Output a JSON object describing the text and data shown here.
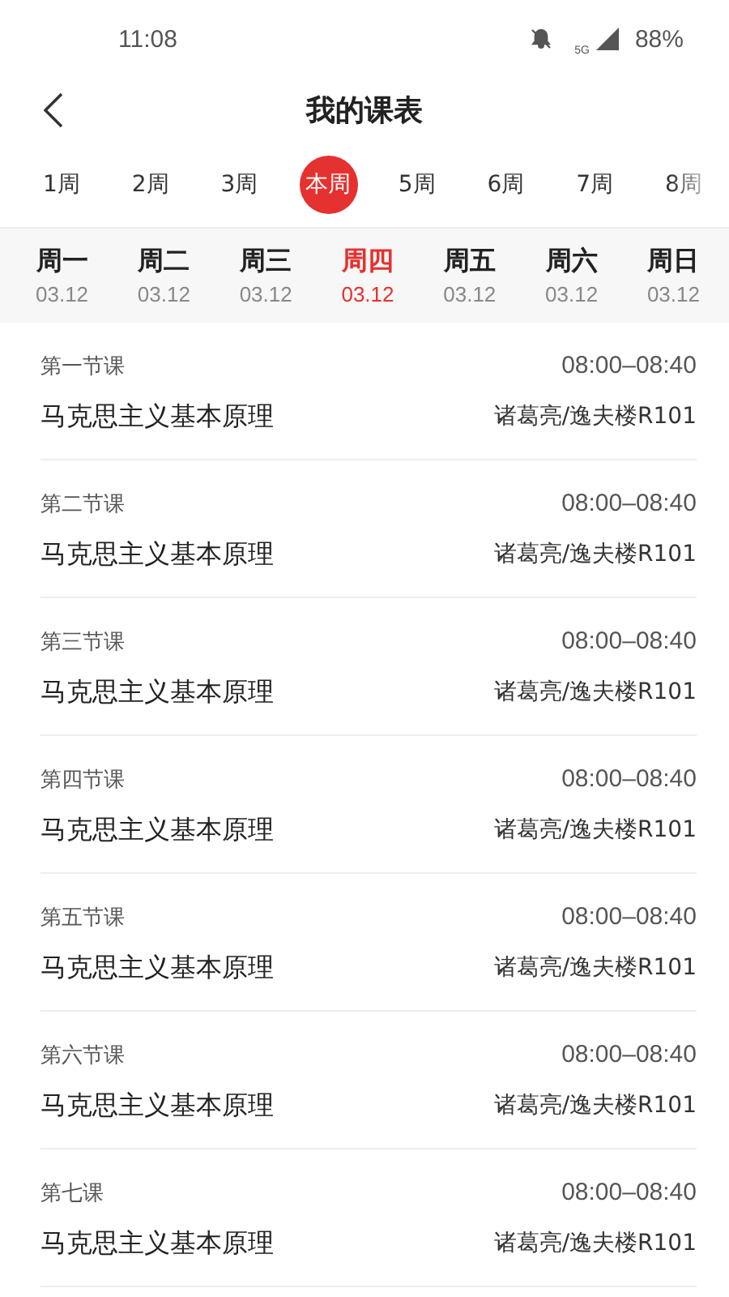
{
  "status_bar": {
    "time": "11:08",
    "network": "5G",
    "battery": "88%"
  },
  "header": {
    "title": "我的课表"
  },
  "weeks": [
    {
      "label": "1周",
      "selected": false
    },
    {
      "label": "2周",
      "selected": false
    },
    {
      "label": "3周",
      "selected": false
    },
    {
      "label": "本周",
      "selected": true
    },
    {
      "label": "5周",
      "selected": false
    },
    {
      "label": "6周",
      "selected": false
    },
    {
      "label": "7周",
      "selected": false
    },
    {
      "label": "8周",
      "selected": false
    }
  ],
  "days": [
    {
      "name": "周一",
      "date": "03.12",
      "selected": false
    },
    {
      "name": "周二",
      "date": "03.12",
      "selected": false
    },
    {
      "name": "周三",
      "date": "03.12",
      "selected": false
    },
    {
      "name": "周四",
      "date": "03.12",
      "selected": true
    },
    {
      "name": "周五",
      "date": "03.12",
      "selected": false
    },
    {
      "name": "周六",
      "date": "03.12",
      "selected": false
    },
    {
      "name": "周日",
      "date": "03.12",
      "selected": false
    }
  ],
  "lessons": [
    {
      "period": "第一节课",
      "time": "08:00–08:40",
      "course": "马克思主义基本原理",
      "place": "诸葛亮/逸夫楼R101"
    },
    {
      "period": "第二节课",
      "time": "08:00–08:40",
      "course": "马克思主义基本原理",
      "place": "诸葛亮/逸夫楼R101"
    },
    {
      "period": "第三节课",
      "time": "08:00–08:40",
      "course": "马克思主义基本原理",
      "place": "诸葛亮/逸夫楼R101"
    },
    {
      "period": "第四节课",
      "time": "08:00–08:40",
      "course": "马克思主义基本原理",
      "place": "诸葛亮/逸夫楼R101"
    },
    {
      "period": "第五节课",
      "time": "08:00–08:40",
      "course": "马克思主义基本原理",
      "place": "诸葛亮/逸夫楼R101"
    },
    {
      "period": "第六节课",
      "time": "08:00–08:40",
      "course": "马克思主义基本原理",
      "place": "诸葛亮/逸夫楼R101"
    },
    {
      "period": "第七课",
      "time": "08:00–08:40",
      "course": "马克思主义基本原理",
      "place": "诸葛亮/逸夫楼R101"
    }
  ]
}
